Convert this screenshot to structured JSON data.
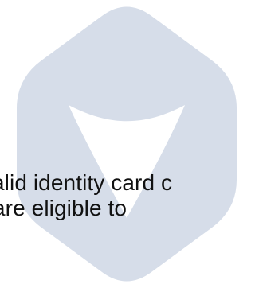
{
  "logo": {
    "icon": "hexagon-triangle-logo",
    "colors": {
      "hexagon": "#d6dde9",
      "triangle": "#ffffff"
    }
  },
  "text": {
    "line_1": "alid identity card c",
    "line_2": "are eligible to"
  },
  "colors": {
    "background": "#ffffff",
    "text": "#111111"
  }
}
